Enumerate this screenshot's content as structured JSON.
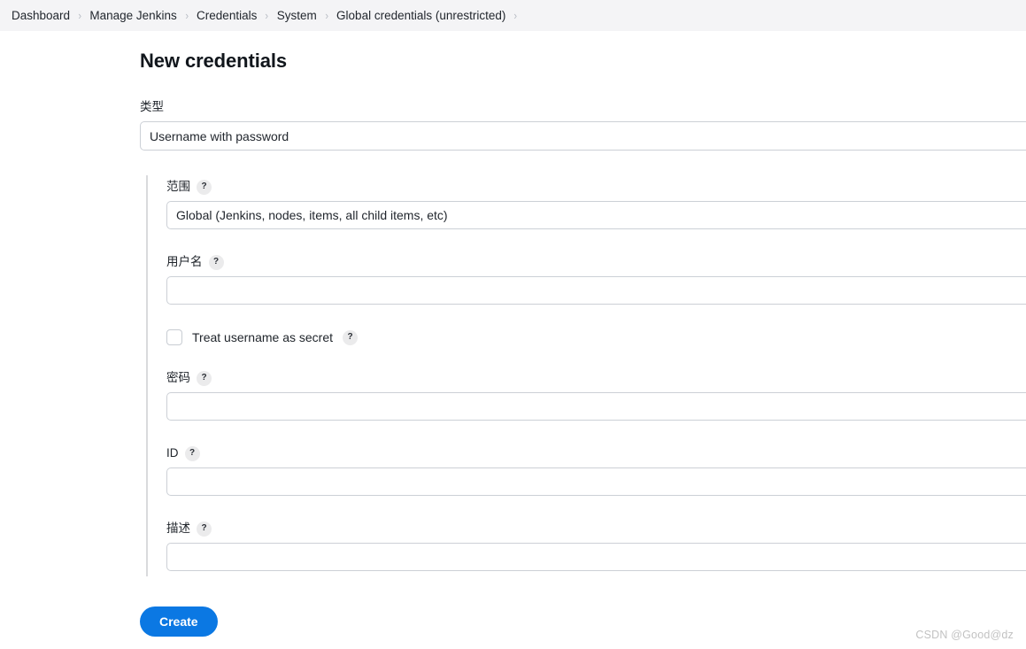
{
  "breadcrumb": {
    "items": [
      {
        "label": "Dashboard"
      },
      {
        "label": "Manage Jenkins"
      },
      {
        "label": "Credentials"
      },
      {
        "label": "System"
      },
      {
        "label": "Global credentials (unrestricted)"
      }
    ],
    "separator": "›"
  },
  "page": {
    "title": "New credentials"
  },
  "form": {
    "kind": {
      "label": "类型",
      "value": "Username with password"
    },
    "scope": {
      "label": "范围",
      "help": "?",
      "value": "Global (Jenkins, nodes, items, all child items, etc)"
    },
    "username": {
      "label": "用户名",
      "help": "?",
      "value": "",
      "placeholder": ""
    },
    "treat_username_as_secret": {
      "label": "Treat username as secret",
      "help": "?",
      "checked": false
    },
    "password": {
      "label": "密码",
      "help": "?",
      "value": "",
      "placeholder": ""
    },
    "id": {
      "label": "ID",
      "help": "?",
      "value": "",
      "placeholder": ""
    },
    "description": {
      "label": "描述",
      "help": "?",
      "value": "",
      "placeholder": ""
    },
    "submit": {
      "label": "Create"
    }
  },
  "watermark": {
    "text": "CSDN @Good@dz"
  },
  "colors": {
    "accent": "#0b78e3",
    "header_bg": "#f4f4f6",
    "border": "#ccd0d6",
    "rule": "#d9dadd"
  }
}
